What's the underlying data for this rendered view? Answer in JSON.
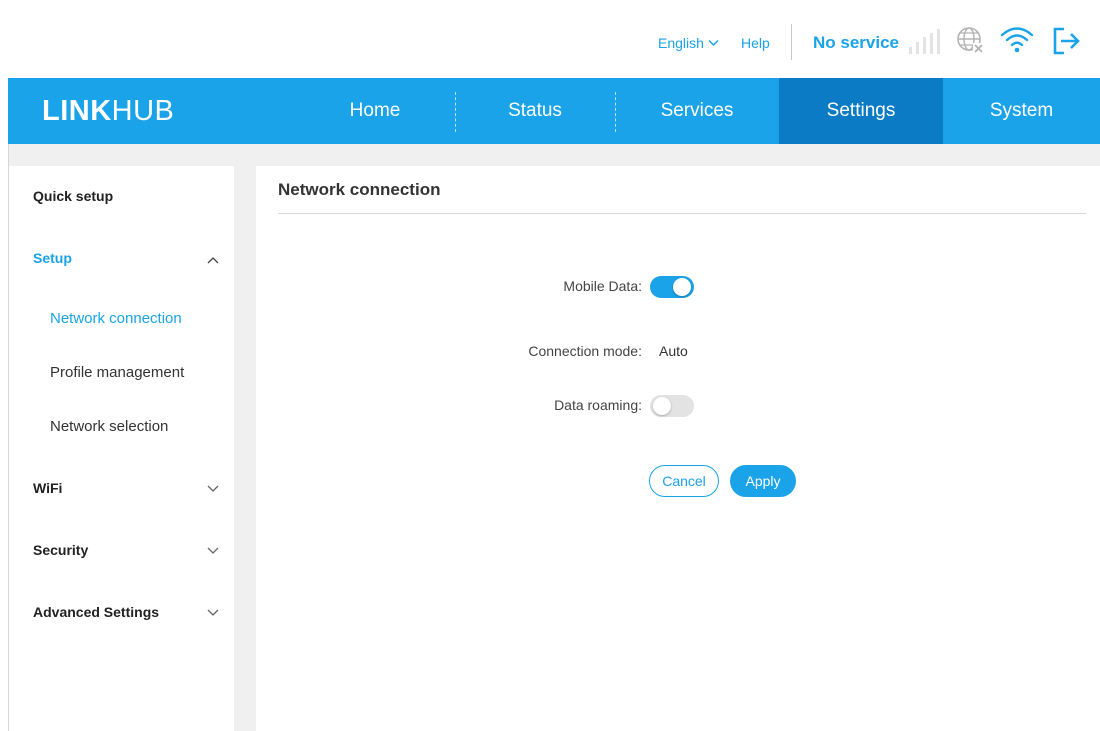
{
  "header": {
    "language": "English",
    "help": "Help",
    "status": "No service",
    "icons": [
      "signal-icon",
      "globe-no-internet-icon",
      "wifi-icon",
      "logout-icon"
    ]
  },
  "nav": {
    "logo_bold": "LINK",
    "logo_thin": "HUB",
    "items": [
      {
        "label": "Home"
      },
      {
        "label": "Status"
      },
      {
        "label": "Services"
      },
      {
        "label": "Settings",
        "active": true
      },
      {
        "label": "System"
      }
    ]
  },
  "sidebar": {
    "quick_setup": "Quick setup",
    "setup": "Setup",
    "setup_items": [
      "Network connection",
      "Profile management",
      "Network selection"
    ],
    "wifi": "WiFi",
    "security": "Security",
    "advanced": "Advanced Settings"
  },
  "content": {
    "title": "Network connection",
    "mobile_data_label": "Mobile Data:",
    "mobile_data_on": true,
    "connection_mode_label": "Connection mode:",
    "connection_mode_value": "Auto",
    "data_roaming_label": "Data roaming:",
    "data_roaming_on": false,
    "cancel": "Cancel",
    "apply": "Apply"
  },
  "colors": {
    "accent": "#1aa3e8",
    "nav_active": "#0a7bc4"
  }
}
